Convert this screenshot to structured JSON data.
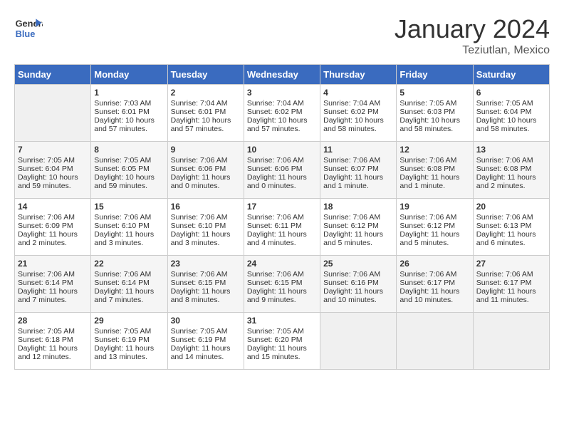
{
  "header": {
    "logo_line1": "General",
    "logo_line2": "Blue",
    "month": "January 2024",
    "location": "Teziutlan, Mexico"
  },
  "days_of_week": [
    "Sunday",
    "Monday",
    "Tuesday",
    "Wednesday",
    "Thursday",
    "Friday",
    "Saturday"
  ],
  "weeks": [
    [
      {
        "day": "",
        "empty": true
      },
      {
        "day": "1",
        "sunrise": "Sunrise: 7:03 AM",
        "sunset": "Sunset: 6:01 PM",
        "daylight": "Daylight: 10 hours and 57 minutes."
      },
      {
        "day": "2",
        "sunrise": "Sunrise: 7:04 AM",
        "sunset": "Sunset: 6:01 PM",
        "daylight": "Daylight: 10 hours and 57 minutes."
      },
      {
        "day": "3",
        "sunrise": "Sunrise: 7:04 AM",
        "sunset": "Sunset: 6:02 PM",
        "daylight": "Daylight: 10 hours and 57 minutes."
      },
      {
        "day": "4",
        "sunrise": "Sunrise: 7:04 AM",
        "sunset": "Sunset: 6:02 PM",
        "daylight": "Daylight: 10 hours and 58 minutes."
      },
      {
        "day": "5",
        "sunrise": "Sunrise: 7:05 AM",
        "sunset": "Sunset: 6:03 PM",
        "daylight": "Daylight: 10 hours and 58 minutes."
      },
      {
        "day": "6",
        "sunrise": "Sunrise: 7:05 AM",
        "sunset": "Sunset: 6:04 PM",
        "daylight": "Daylight: 10 hours and 58 minutes."
      }
    ],
    [
      {
        "day": "7",
        "sunrise": "Sunrise: 7:05 AM",
        "sunset": "Sunset: 6:04 PM",
        "daylight": "Daylight: 10 hours and 59 minutes."
      },
      {
        "day": "8",
        "sunrise": "Sunrise: 7:05 AM",
        "sunset": "Sunset: 6:05 PM",
        "daylight": "Daylight: 10 hours and 59 minutes."
      },
      {
        "day": "9",
        "sunrise": "Sunrise: 7:06 AM",
        "sunset": "Sunset: 6:06 PM",
        "daylight": "Daylight: 11 hours and 0 minutes."
      },
      {
        "day": "10",
        "sunrise": "Sunrise: 7:06 AM",
        "sunset": "Sunset: 6:06 PM",
        "daylight": "Daylight: 11 hours and 0 minutes."
      },
      {
        "day": "11",
        "sunrise": "Sunrise: 7:06 AM",
        "sunset": "Sunset: 6:07 PM",
        "daylight": "Daylight: 11 hours and 1 minute."
      },
      {
        "day": "12",
        "sunrise": "Sunrise: 7:06 AM",
        "sunset": "Sunset: 6:08 PM",
        "daylight": "Daylight: 11 hours and 1 minute."
      },
      {
        "day": "13",
        "sunrise": "Sunrise: 7:06 AM",
        "sunset": "Sunset: 6:08 PM",
        "daylight": "Daylight: 11 hours and 2 minutes."
      }
    ],
    [
      {
        "day": "14",
        "sunrise": "Sunrise: 7:06 AM",
        "sunset": "Sunset: 6:09 PM",
        "daylight": "Daylight: 11 hours and 2 minutes."
      },
      {
        "day": "15",
        "sunrise": "Sunrise: 7:06 AM",
        "sunset": "Sunset: 6:10 PM",
        "daylight": "Daylight: 11 hours and 3 minutes."
      },
      {
        "day": "16",
        "sunrise": "Sunrise: 7:06 AM",
        "sunset": "Sunset: 6:10 PM",
        "daylight": "Daylight: 11 hours and 3 minutes."
      },
      {
        "day": "17",
        "sunrise": "Sunrise: 7:06 AM",
        "sunset": "Sunset: 6:11 PM",
        "daylight": "Daylight: 11 hours and 4 minutes."
      },
      {
        "day": "18",
        "sunrise": "Sunrise: 7:06 AM",
        "sunset": "Sunset: 6:12 PM",
        "daylight": "Daylight: 11 hours and 5 minutes."
      },
      {
        "day": "19",
        "sunrise": "Sunrise: 7:06 AM",
        "sunset": "Sunset: 6:12 PM",
        "daylight": "Daylight: 11 hours and 5 minutes."
      },
      {
        "day": "20",
        "sunrise": "Sunrise: 7:06 AM",
        "sunset": "Sunset: 6:13 PM",
        "daylight": "Daylight: 11 hours and 6 minutes."
      }
    ],
    [
      {
        "day": "21",
        "sunrise": "Sunrise: 7:06 AM",
        "sunset": "Sunset: 6:14 PM",
        "daylight": "Daylight: 11 hours and 7 minutes."
      },
      {
        "day": "22",
        "sunrise": "Sunrise: 7:06 AM",
        "sunset": "Sunset: 6:14 PM",
        "daylight": "Daylight: 11 hours and 7 minutes."
      },
      {
        "day": "23",
        "sunrise": "Sunrise: 7:06 AM",
        "sunset": "Sunset: 6:15 PM",
        "daylight": "Daylight: 11 hours and 8 minutes."
      },
      {
        "day": "24",
        "sunrise": "Sunrise: 7:06 AM",
        "sunset": "Sunset: 6:15 PM",
        "daylight": "Daylight: 11 hours and 9 minutes."
      },
      {
        "day": "25",
        "sunrise": "Sunrise: 7:06 AM",
        "sunset": "Sunset: 6:16 PM",
        "daylight": "Daylight: 11 hours and 10 minutes."
      },
      {
        "day": "26",
        "sunrise": "Sunrise: 7:06 AM",
        "sunset": "Sunset: 6:17 PM",
        "daylight": "Daylight: 11 hours and 10 minutes."
      },
      {
        "day": "27",
        "sunrise": "Sunrise: 7:06 AM",
        "sunset": "Sunset: 6:17 PM",
        "daylight": "Daylight: 11 hours and 11 minutes."
      }
    ],
    [
      {
        "day": "28",
        "sunrise": "Sunrise: 7:05 AM",
        "sunset": "Sunset: 6:18 PM",
        "daylight": "Daylight: 11 hours and 12 minutes."
      },
      {
        "day": "29",
        "sunrise": "Sunrise: 7:05 AM",
        "sunset": "Sunset: 6:19 PM",
        "daylight": "Daylight: 11 hours and 13 minutes."
      },
      {
        "day": "30",
        "sunrise": "Sunrise: 7:05 AM",
        "sunset": "Sunset: 6:19 PM",
        "daylight": "Daylight: 11 hours and 14 minutes."
      },
      {
        "day": "31",
        "sunrise": "Sunrise: 7:05 AM",
        "sunset": "Sunset: 6:20 PM",
        "daylight": "Daylight: 11 hours and 15 minutes."
      },
      {
        "day": "",
        "empty": true
      },
      {
        "day": "",
        "empty": true
      },
      {
        "day": "",
        "empty": true
      }
    ]
  ]
}
